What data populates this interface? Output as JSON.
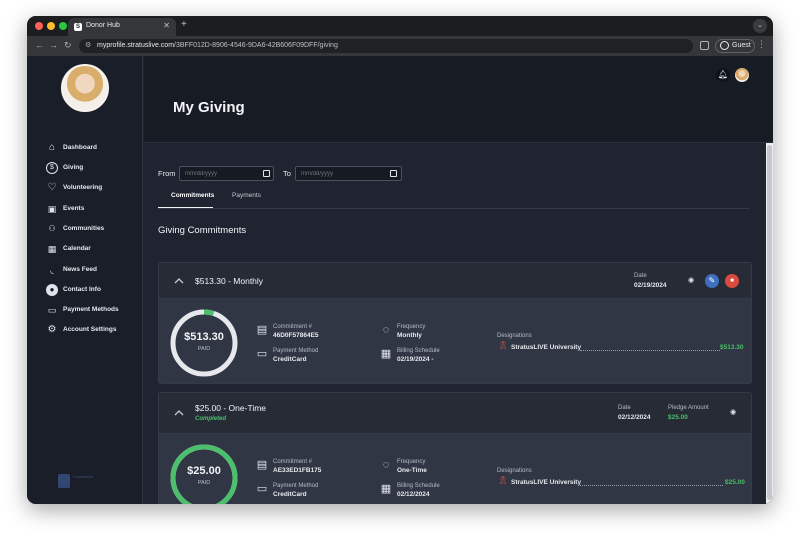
{
  "browser": {
    "tab_title": "Donor Hub",
    "tab_favicon": "S",
    "url_host": "myprofile.stratuslive.com",
    "url_path": "/3BFF012D-8906-4546-9DA6-42B606F09DFF/giving",
    "profile_label": "Guest"
  },
  "sidebar": {
    "items": [
      {
        "label": "Dashboard",
        "icon": "home-icon"
      },
      {
        "label": "Giving",
        "icon": "dollar-icon"
      },
      {
        "label": "Volunteering",
        "icon": "heart-icon"
      },
      {
        "label": "Events",
        "icon": "calendar-event-icon"
      },
      {
        "label": "Communities",
        "icon": "users-icon"
      },
      {
        "label": "Calendar",
        "icon": "calendar-icon"
      },
      {
        "label": "News Feed",
        "icon": "rss-icon"
      },
      {
        "label": "Contact Info",
        "icon": "user-icon"
      },
      {
        "label": "Payment Methods",
        "icon": "credit-card-icon"
      },
      {
        "label": "Account Settings",
        "icon": "gear-icon"
      }
    ],
    "logo_text": "Foundation"
  },
  "header": {
    "title": "My Giving"
  },
  "filters": {
    "from_label": "From",
    "to_label": "To",
    "date_placeholder": "mm/dd/yyyy"
  },
  "tabs": [
    {
      "label": "Commitments",
      "active": true
    },
    {
      "label": "Payments",
      "active": false
    }
  ],
  "section_title": "Giving Commitments",
  "commitments": [
    {
      "title": "$513.30 - Monthly",
      "status": "",
      "date_label": "Date",
      "date": "02/19/2024",
      "pledge_label": "",
      "pledge_amount": "",
      "paid_amount": "$513.30",
      "paid_label": "PAID",
      "paid_fraction": 0.05,
      "commitment_label": "Commitment #",
      "commitment_number": "46D0F57864E5",
      "payment_label": "Payment Method",
      "payment_method": "CreditCard",
      "frequency_label": "Frequency",
      "frequency": "Monthly",
      "schedule_label": "Billing Schedule",
      "schedule": "02/19/2024 -",
      "designations_label": "Designations",
      "designation_name": "StratusLIVE University",
      "designation_amount": "$513.30"
    },
    {
      "title": "$25.00 - One-Time",
      "status": "Completed",
      "date_label": "Date",
      "date": "02/12/2024",
      "pledge_label": "Pledge Amount",
      "pledge_amount": "$25.00",
      "paid_amount": "$25.00",
      "paid_label": "PAID",
      "paid_fraction": 1.0,
      "commitment_label": "Commitment #",
      "commitment_number": "AE33ED1FB175",
      "payment_label": "Payment Method",
      "payment_method": "CreditCard",
      "frequency_label": "Frequency",
      "frequency": "One-Time",
      "schedule_label": "Billing Schedule",
      "schedule": "02/12/2024",
      "designations_label": "Designations",
      "designation_name": "StratusLIVE University",
      "designation_amount": "$25.00"
    }
  ],
  "colors": {
    "accent_green": "#4bbf6b",
    "edit_blue": "#3f6fbf",
    "cancel_red": "#d84b3e"
  }
}
